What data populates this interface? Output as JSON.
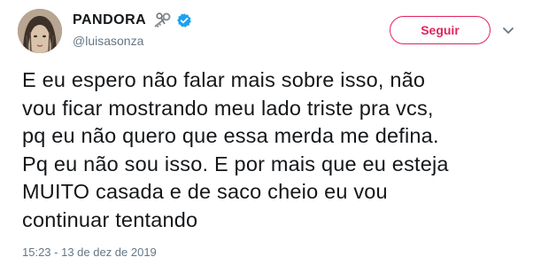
{
  "author": {
    "display_name": "PANDORA",
    "handle": "@luisasonza",
    "name_emoji": "old-key-icon",
    "verified": true
  },
  "actions": {
    "follow_label": "Seguir",
    "menu_icon": "chevron-down-icon"
  },
  "tweet": {
    "lines": [
      "E eu espero não falar mais sobre isso, não",
      "vou ficar mostrando meu lado triste pra vcs,",
      "pq eu não quero que essa merda me defina.",
      "Pq eu não sou isso. E por mais que eu esteja",
      "MUITO casada e de saco cheio eu vou",
      "continuar tentando"
    ],
    "timestamp": "15:23 - 13 de dez de 2019"
  },
  "colors": {
    "accent": "#e0245e",
    "verified": "#1da1f2",
    "text": "#14171a",
    "muted": "#657786"
  }
}
